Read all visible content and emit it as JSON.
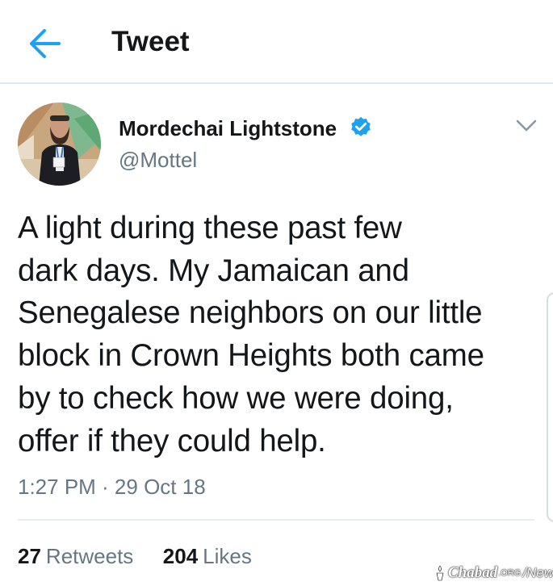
{
  "header": {
    "title": "Tweet"
  },
  "author": {
    "name": "Mordechai Lightstone",
    "handle": "@Mottel"
  },
  "tweet": {
    "lines": [
      "A light during these past few",
      "dark days. My Jamaican and",
      "Senegalese neighbors on our little",
      "block in Crown Heights both came",
      "by to check how we were doing,",
      "offer if they could help."
    ],
    "timestamp": "1:27 PM · 29 Oct 18"
  },
  "stats": {
    "retweets_count": "27",
    "retweets_label": "Retweets",
    "likes_count": "204",
    "likes_label": "Likes"
  },
  "watermark": {
    "brand": "Chabad",
    "org": ".ORG",
    "news": "/News"
  },
  "colors": {
    "accent": "#1da1f2",
    "text": "#14171a",
    "secondary_text": "#657786",
    "divider": "#e6ecf0"
  },
  "icons": {
    "back": "arrow-left-icon",
    "verified": "verified-badge-icon",
    "caret": "chevron-down-icon"
  }
}
